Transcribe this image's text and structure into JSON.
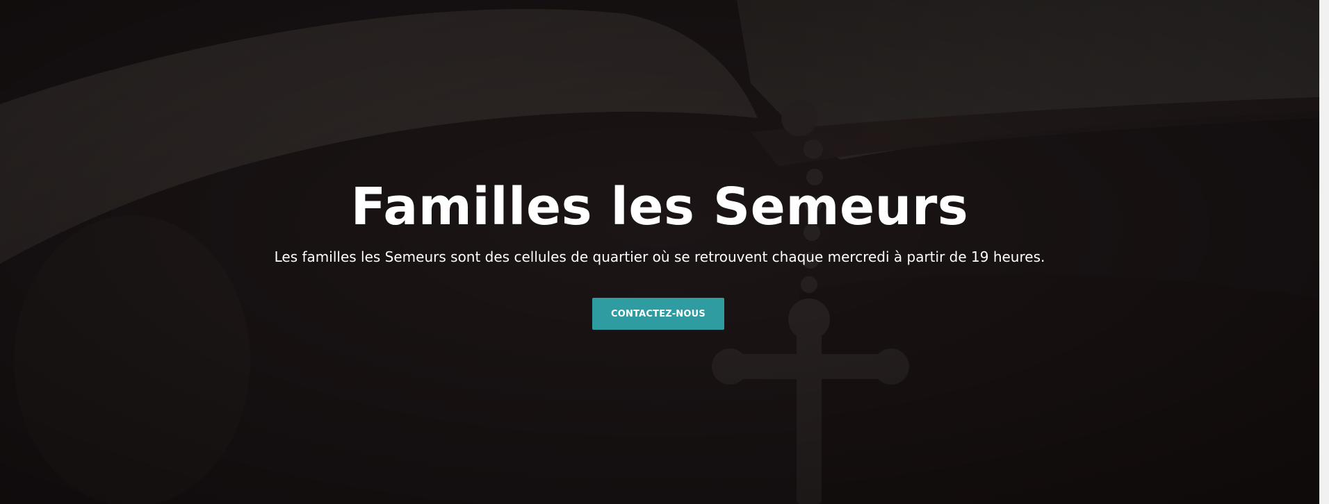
{
  "hero": {
    "background_image": "open-bible-with-crucifix-rosary-photo",
    "title": "Familles les Semeurs",
    "subtitle": "Les familles les Semeurs sont des cellules de quartier où se retrouvent chaque mercredi à partir de 19 heures.",
    "cta_label": "CONTACTEZ-NOUS"
  },
  "colors": {
    "overlay": "#1c1516",
    "accent": "#2e9ca1",
    "text": "#ffffff"
  }
}
